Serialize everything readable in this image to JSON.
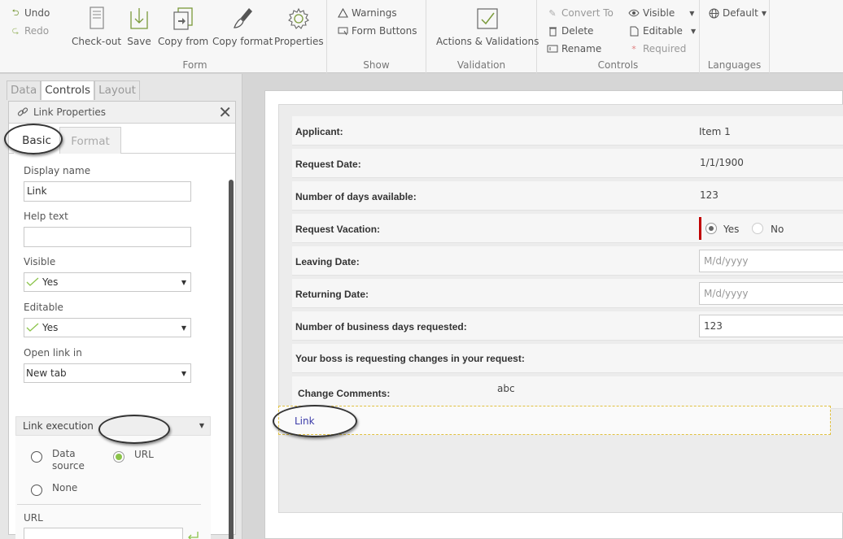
{
  "ribbon": {
    "undo": "Undo",
    "redo": "Redo",
    "form": {
      "label": "Form",
      "checkout": "Check-out",
      "save": "Save",
      "copy_from": "Copy from",
      "copy_format": "Copy format",
      "properties": "Properties"
    },
    "show": {
      "label": "Show",
      "warnings": "Warnings",
      "form_buttons": "Form Buttons"
    },
    "validation": {
      "label": "Validation",
      "actions": "Actions & Validations"
    },
    "controls": {
      "label": "Controls",
      "convert_to": "Convert To",
      "delete": "Delete",
      "rename": "Rename",
      "visible": "Visible",
      "editable": "Editable",
      "required": "Required"
    },
    "languages": {
      "label": "Languages",
      "default": "Default"
    }
  },
  "left_tabs": [
    "Data",
    "Controls",
    "Layout"
  ],
  "props": {
    "title": "Link Properties",
    "tab_basic": "Basic",
    "tab_format": "Format",
    "display_name_label": "Display name",
    "display_name_value": "Link",
    "help_text_label": "Help text",
    "help_text_value": "",
    "visible_label": "Visible",
    "visible_value": "Yes",
    "editable_label": "Editable",
    "editable_value": "Yes",
    "open_link_label": "Open link in",
    "open_link_value": "New tab",
    "link_execution_label": "Link execution",
    "opt_data_source_1": "Data",
    "opt_data_source_2": "source",
    "opt_url": "URL",
    "opt_none": "None",
    "url_label": "URL",
    "url_value": ""
  },
  "form": {
    "rows": [
      {
        "label": "Applicant:",
        "value": "Item 1"
      },
      {
        "label": "Request Date:",
        "value": "1/1/1900"
      },
      {
        "label": "Number of days available:",
        "value": "123"
      },
      {
        "label": "Request Vacation:",
        "yes": "Yes",
        "no": "No"
      },
      {
        "label": "Leaving Date:",
        "placeholder": "M/d/yyyy"
      },
      {
        "label": "Returning Date:",
        "placeholder": "M/d/yyyy"
      },
      {
        "label": "Number of business days requested:",
        "value": "123"
      },
      {
        "label": "Your boss is requesting changes in your request:"
      },
      {
        "label": "Change Comments:",
        "value": "abc"
      }
    ],
    "link_text": "Link"
  },
  "colors": {
    "accent_green": "#8bc34a",
    "required_red": "#c00000",
    "link_blue": "#3a3aa8"
  }
}
